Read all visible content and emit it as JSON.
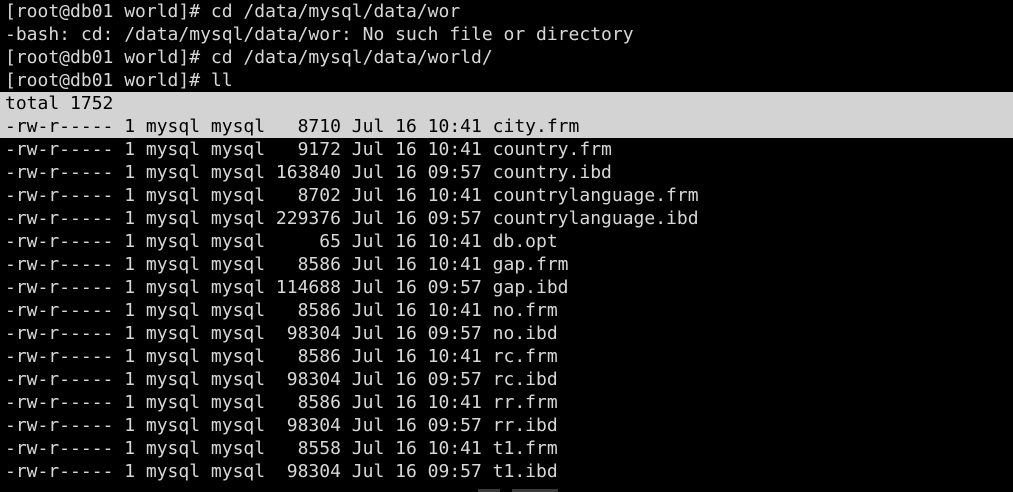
{
  "terminal": {
    "lines": [
      "[root@db01 world]# cd /data/mysql/data/wor",
      "-bash: cd: /data/mysql/data/wor: No such file or directory",
      "[root@db01 world]# cd /data/mysql/data/world/",
      "[root@db01 world]# ll"
    ],
    "selected": [
      "total 1752",
      "-rw-r----- 1 mysql mysql   8710 Jul 16 10:41 city.frm"
    ],
    "listing": [
      "-rw-r----- 1 mysql mysql   9172 Jul 16 10:41 country.frm",
      "-rw-r----- 1 mysql mysql 163840 Jul 16 09:57 country.ibd",
      "-rw-r----- 1 mysql mysql   8702 Jul 16 10:41 countrylanguage.frm",
      "-rw-r----- 1 mysql mysql 229376 Jul 16 09:57 countrylanguage.ibd",
      "-rw-r----- 1 mysql mysql     65 Jul 16 10:41 db.opt",
      "-rw-r----- 1 mysql mysql   8586 Jul 16 10:41 gap.frm",
      "-rw-r----- 1 mysql mysql 114688 Jul 16 09:57 gap.ibd",
      "-rw-r----- 1 mysql mysql   8586 Jul 16 10:41 no.frm",
      "-rw-r----- 1 mysql mysql  98304 Jul 16 09:57 no.ibd",
      "-rw-r----- 1 mysql mysql   8586 Jul 16 10:41 rc.frm",
      "-rw-r----- 1 mysql mysql  98304 Jul 16 09:57 rc.ibd",
      "-rw-r----- 1 mysql mysql   8586 Jul 16 10:41 rr.frm",
      "-rw-r----- 1 mysql mysql  98304 Jul 16 09:57 rr.ibd",
      "-rw-r----- 1 mysql mysql   8558 Jul 16 10:41 t1.frm",
      "-rw-r----- 1 mysql mysql  98304 Jul 16 09:57 t1.ibd"
    ]
  },
  "colors": {
    "background": "#000000",
    "foreground": "#d8d8d8",
    "selection_bg": "#d3d3d3",
    "selection_fg": "#000000"
  }
}
